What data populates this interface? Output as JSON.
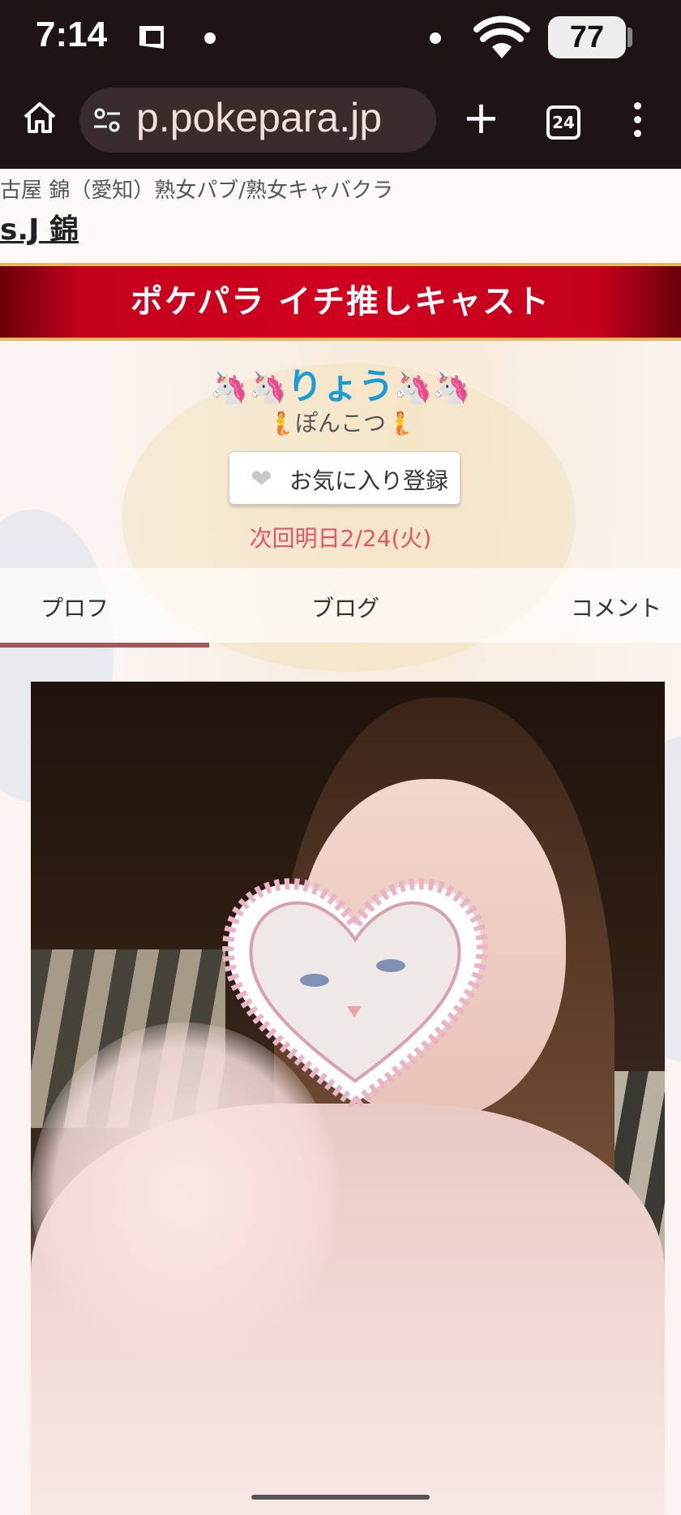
{
  "status_bar": {
    "time": "7:14",
    "battery": "77"
  },
  "browser": {
    "url": "p.pokepara.jp",
    "tab_count": "24"
  },
  "shop": {
    "breadcrumb": "古屋 錦（愛知）熟女パブ/熟女キャバクラ",
    "name": "s.J 錦"
  },
  "banner": {
    "title": "ポケパラ イチ推しキャスト"
  },
  "cast": {
    "name": "りょう",
    "name_prefix_emoji": "🦄🦄",
    "name_suffix_emoji": "🦄🦄",
    "catchphrase": "🧜ぽんこつ🧜",
    "favorite_button": "お気に入り登録",
    "next_shift": "次回明日2/24(火)"
  },
  "tabs": [
    {
      "label": "プロフ",
      "active": true
    },
    {
      "label": "ブログ",
      "active": false
    },
    {
      "label": "コメント",
      "active": false
    }
  ],
  "colors": {
    "status_bg": "#1e1414",
    "banner_red": "#c4001c",
    "name_blue": "#1a9bd6",
    "date_pink": "#e0556a",
    "tab_indicator": "#a05a5a"
  }
}
